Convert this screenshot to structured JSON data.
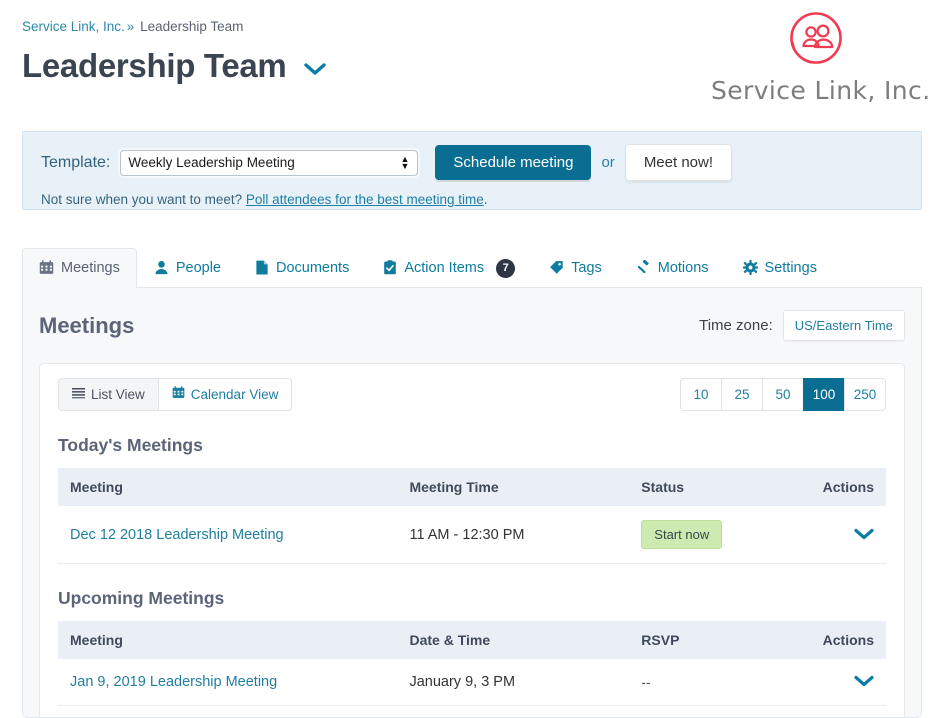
{
  "header": {
    "breadcrumb_org": "Service Link, Inc.",
    "breadcrumb_sep": "»",
    "breadcrumb_current": "Leadership Team",
    "title": "Leadership Team",
    "title_caret_icon": "chevron-down-icon",
    "logo_icon": "people-circle-icon",
    "logo_text": "Service Link, Inc.",
    "logo_color": "#ef3b52"
  },
  "infobar": {
    "template_label": "Template:",
    "template_selected": "Weekly Leadership Meeting",
    "template_options": [
      "Weekly Leadership Meeting"
    ],
    "schedule_button": "Schedule meeting",
    "or_text": "or",
    "meet_now_button": "Meet now!",
    "poll_prefix": "Not sure when you want to meet?",
    "poll_link": "Poll attendees for the best meeting time",
    "poll_suffix": "."
  },
  "tabs": [
    {
      "label": "Meetings",
      "icon": "calendar-icon",
      "icon_glyph": "▦",
      "active": true,
      "badge": null
    },
    {
      "label": "People",
      "icon": "person-icon",
      "icon_glyph": "👤",
      "active": false,
      "badge": null
    },
    {
      "label": "Documents",
      "icon": "document-icon",
      "icon_glyph": "📄",
      "active": false,
      "badge": null
    },
    {
      "label": "Action Items",
      "icon": "clipboard-check-icon",
      "icon_glyph": "☑",
      "active": false,
      "badge": "7"
    },
    {
      "label": "Tags",
      "icon": "tag-icon",
      "icon_glyph": "🏷",
      "active": false,
      "badge": null
    },
    {
      "label": "Motions",
      "icon": "gavel-icon",
      "icon_glyph": "🔨",
      "active": false,
      "badge": null
    },
    {
      "label": "Settings",
      "icon": "gear-icon",
      "icon_glyph": "⚙",
      "active": false,
      "badge": null
    }
  ],
  "panel": {
    "title": "Meetings",
    "timezone_label": "Time zone:",
    "timezone_value": "US/Eastern Time",
    "view_buttons": [
      {
        "label": "List View",
        "icon": "list-icon",
        "icon_glyph": "☰",
        "active": true
      },
      {
        "label": "Calendar View",
        "icon": "calendar-icon",
        "icon_glyph": "▦",
        "active": false
      }
    ],
    "page_sizes": [
      {
        "label": "10",
        "active": false
      },
      {
        "label": "25",
        "active": false
      },
      {
        "label": "50",
        "active": false
      },
      {
        "label": "100",
        "active": true
      },
      {
        "label": "250",
        "active": false
      }
    ],
    "sections": [
      {
        "title": "Today's Meetings",
        "columns": [
          "Meeting",
          "Meeting Time",
          "Status",
          "Actions"
        ],
        "rows": [
          {
            "meeting": "Dec 12 2018 Leadership Meeting",
            "time": "11 AM - 12:30 PM",
            "status": "Start now",
            "status_type": "button",
            "action_icon": "chevron-down-icon"
          }
        ]
      },
      {
        "title": "Upcoming Meetings",
        "columns": [
          "Meeting",
          "Date & Time",
          "RSVP",
          "Actions"
        ],
        "rows": [
          {
            "meeting": "Jan 9, 2019 Leadership Meeting",
            "time": "January 9, 3 PM",
            "status": "--",
            "status_type": "text",
            "action_icon": "chevron-down-icon"
          }
        ]
      }
    ]
  },
  "colors": {
    "accent": "#0a6e93",
    "link": "#1f7fa0",
    "brand_red": "#ef3b52",
    "success_bg": "#cdeab0"
  }
}
